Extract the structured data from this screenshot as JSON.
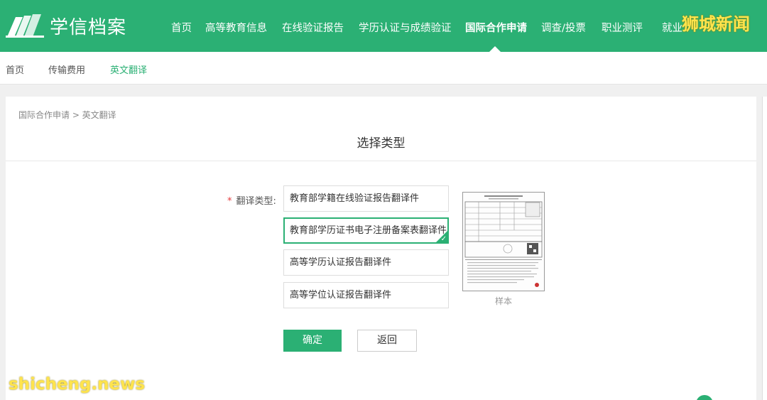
{
  "header": {
    "logo_text": "学信档案",
    "nav": [
      {
        "label": "首页"
      },
      {
        "label": "高等教育信息"
      },
      {
        "label": "在线验证报告"
      },
      {
        "label": "学历认证与成绩验证"
      },
      {
        "label": "国际合作申请"
      },
      {
        "label": "调查/投票"
      },
      {
        "label": "职业测评"
      },
      {
        "label": "就业"
      }
    ],
    "active_nav": "国际合作申请",
    "accent_color": "#2bb074"
  },
  "subnav": {
    "items": [
      {
        "label": "首页"
      },
      {
        "label": "传输费用"
      },
      {
        "label": "英文翻译"
      }
    ],
    "active": "英文翻译"
  },
  "breadcrumb": "国际合作申请 > 英文翻译",
  "page_title": "选择类型",
  "form": {
    "required_mark": "*",
    "label": "翻译类型:",
    "options": [
      {
        "label": "教育部学籍在线验证报告翻译件",
        "selected": false
      },
      {
        "label": "教育部学历证书电子注册备案表翻译件",
        "selected": true
      },
      {
        "label": "高等学历认证报告翻译件",
        "selected": false
      },
      {
        "label": "高等学位认证报告翻译件",
        "selected": false
      }
    ],
    "sample_caption": "样本",
    "confirm_label": "确定",
    "back_label": "返回"
  },
  "watermarks": {
    "top": "狮城新闻",
    "bottom": "shicheng.news"
  }
}
